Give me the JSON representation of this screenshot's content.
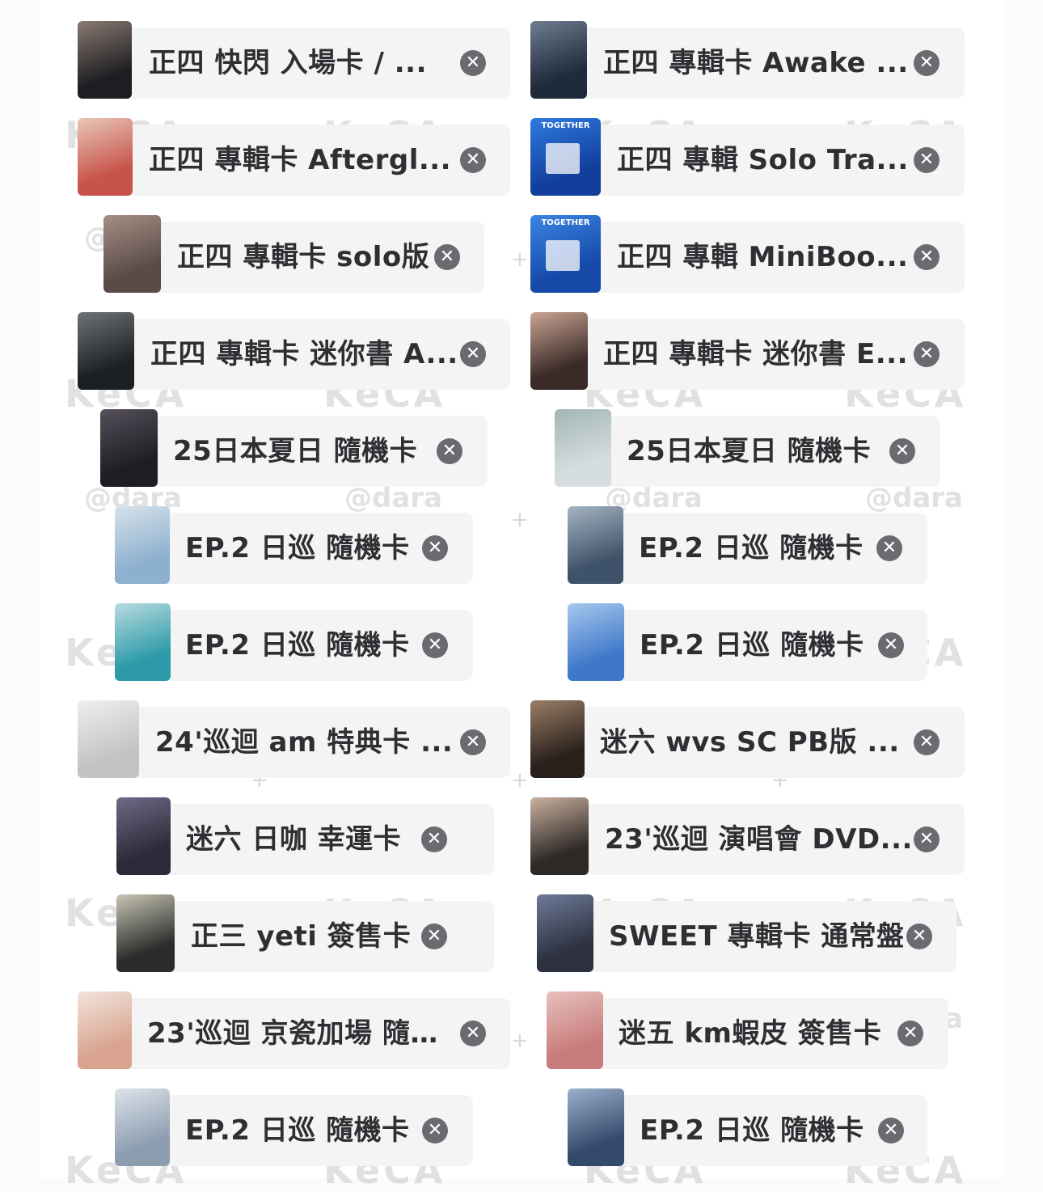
{
  "watermarks": {
    "brand": "KeCA",
    "handle": "@dara"
  },
  "remove_glyph": "✕",
  "items": [
    {
      "label": "正四 快閃 入場卡 / ...",
      "thumb_colors": [
        "#1e1e22",
        "#8a7a72"
      ]
    },
    {
      "label": "正四 專輯卡 Awake ...",
      "thumb_colors": [
        "#1f2a3a",
        "#6f7d90"
      ]
    },
    {
      "label": "正四 專輯卡 Aftergl...",
      "thumb_colors": [
        "#c8534a",
        "#e8c7b8"
      ]
    },
    {
      "label": "正四 專輯 Solo Tra...",
      "thumb_colors": [
        "#123f9c",
        "#2f7be0"
      ],
      "thumb_text": "TOGETHER"
    },
    {
      "label": "正四 專輯卡 solo版",
      "thumb_colors": [
        "#5a4a48",
        "#a58f84"
      ]
    },
    {
      "label": "正四 專輯 MiniBoo...",
      "thumb_colors": [
        "#1648a8",
        "#3a86e2"
      ],
      "thumb_text": "TOGETHER"
    },
    {
      "label": "正四 專輯卡 迷你書 A...",
      "thumb_colors": [
        "#1d2023",
        "#6d7377"
      ]
    },
    {
      "label": "正四 專輯卡 迷你書 E...",
      "thumb_colors": [
        "#3a2a28",
        "#caa493"
      ]
    },
    {
      "label": "25日本夏日 隨機卡",
      "thumb_colors": [
        "#1f1d24",
        "#55505b"
      ]
    },
    {
      "label": "25日本夏日 隨機卡",
      "thumb_colors": [
        "#d6dde0",
        "#a3b5b5"
      ]
    },
    {
      "label": "EP.2 日巡 隨機卡",
      "thumb_colors": [
        "#8db0cf",
        "#d6e2ea"
      ]
    },
    {
      "label": "EP.2 日巡 隨機卡",
      "thumb_colors": [
        "#3e5269",
        "#a5b4c3"
      ]
    },
    {
      "label": "EP.2 日巡 隨機卡",
      "thumb_colors": [
        "#2c9aa8",
        "#b8dbe0"
      ]
    },
    {
      "label": "EP.2 日巡 隨機卡",
      "thumb_colors": [
        "#3f78c9",
        "#a7c8ee"
      ]
    },
    {
      "label": "24'巡迴 am 特典卡 ...",
      "thumb_colors": [
        "#c5c3c2",
        "#f0efee"
      ]
    },
    {
      "label": "迷六 wvs SC PB版 ...",
      "thumb_colors": [
        "#2a201c",
        "#9a7f66"
      ]
    },
    {
      "label": "迷六 日咖 幸運卡",
      "thumb_colors": [
        "#2c2a38",
        "#6f6a86"
      ]
    },
    {
      "label": "23'巡迴 演唱會 DVD...",
      "thumb_colors": [
        "#2e2927",
        "#cab1a0"
      ]
    },
    {
      "label": "正三 yeti 簽售卡",
      "thumb_colors": [
        "#2b2b2b",
        "#c8c6b4"
      ]
    },
    {
      "label": "SWEET 專輯卡 通常盤",
      "thumb_colors": [
        "#2d3140",
        "#6e7a98"
      ]
    },
    {
      "label": "23'巡迴 京瓷加場 隨…",
      "thumb_colors": [
        "#d9a48f",
        "#f2e4dd"
      ]
    },
    {
      "label": "迷五 km蝦皮 簽售卡",
      "thumb_colors": [
        "#c77b7b",
        "#e7c1bd"
      ]
    },
    {
      "label": "EP.2 日巡 隨機卡",
      "thumb_colors": [
        "#8d9db0",
        "#dde3ea"
      ]
    },
    {
      "label": "EP.2 日巡 隨機卡",
      "thumb_colors": [
        "#344a6b",
        "#9bb0cc"
      ]
    }
  ]
}
